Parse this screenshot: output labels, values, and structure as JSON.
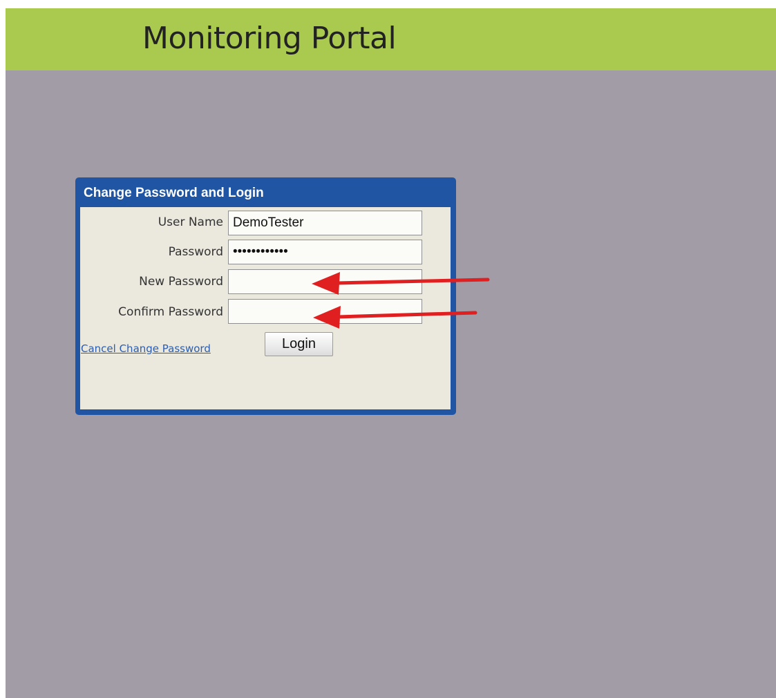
{
  "header": {
    "title": "Monitoring Portal"
  },
  "login_panel": {
    "title": "Change Password and Login",
    "fields": {
      "username": {
        "label": "User Name",
        "value": "DemoTester"
      },
      "password": {
        "label": "Password",
        "value": "demopassword"
      },
      "new_password": {
        "label": "New Password",
        "value": ""
      },
      "confirm_password": {
        "label": "Confirm Password",
        "value": ""
      }
    },
    "cancel_link": "Cancel Change Password",
    "login_button": "Login"
  },
  "annotations": {
    "arrow_color": "#e02020",
    "arrows": [
      "points-to-new-password",
      "points-to-confirm-password"
    ]
  },
  "colors": {
    "header_bg": "#aac94f",
    "page_bg": "#a29ca7",
    "panel_border": "#1f55a3",
    "panel_body": "#ebe8de",
    "link": "#2a5db0"
  }
}
